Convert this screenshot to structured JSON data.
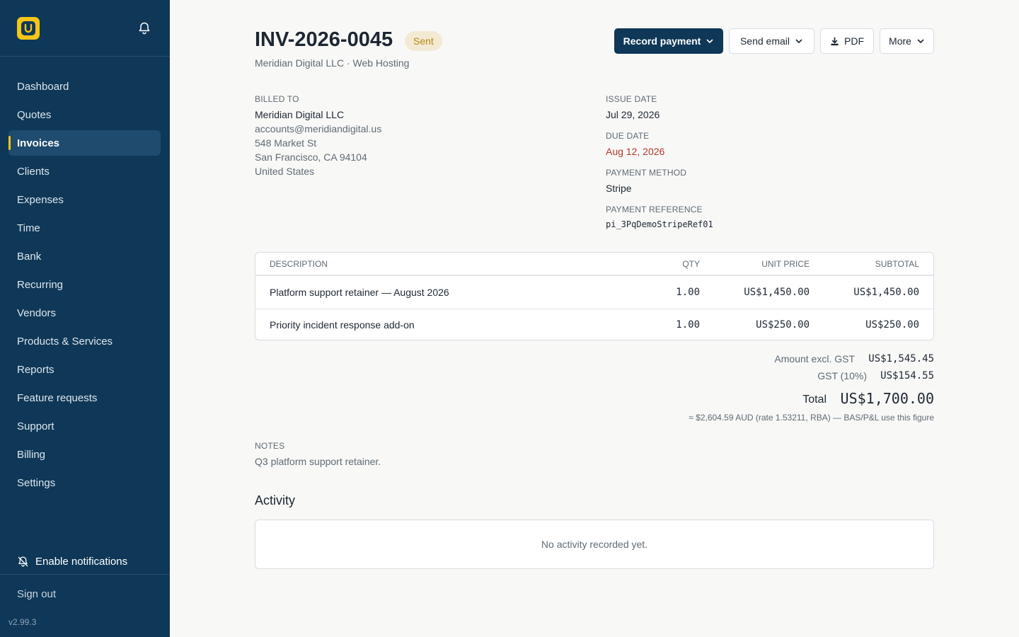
{
  "sidebar": {
    "logo_letter": "U",
    "nav": [
      {
        "label": "Dashboard",
        "active": false
      },
      {
        "label": "Quotes",
        "active": false
      },
      {
        "label": "Invoices",
        "active": true
      },
      {
        "label": "Clients",
        "active": false
      },
      {
        "label": "Expenses",
        "active": false
      },
      {
        "label": "Time",
        "active": false
      },
      {
        "label": "Bank",
        "active": false
      },
      {
        "label": "Recurring",
        "active": false
      },
      {
        "label": "Vendors",
        "active": false
      },
      {
        "label": "Products & Services",
        "active": false
      },
      {
        "label": "Reports",
        "active": false
      },
      {
        "label": "Feature requests",
        "active": false
      },
      {
        "label": "Support",
        "active": false
      },
      {
        "label": "Billing",
        "active": false
      },
      {
        "label": "Settings",
        "active": false
      }
    ],
    "enable_notifications": "Enable notifications",
    "sign_out": "Sign out",
    "version": "v2.99.3"
  },
  "invoice": {
    "number": "INV-2026-0045",
    "status": "Sent",
    "subtitle": "Meridian Digital LLC · Web Hosting"
  },
  "actions": {
    "record_payment": "Record payment",
    "send_email": "Send email",
    "pdf": "PDF",
    "more": "More"
  },
  "billed_to": {
    "label": "BILLED TO",
    "name": "Meridian Digital LLC",
    "email": "accounts@meridiandigital.us",
    "street": "548 Market St",
    "city": "San Francisco, CA 94104",
    "country": "United States"
  },
  "details": {
    "issue_date_label": "ISSUE DATE",
    "issue_date": "Jul 29, 2026",
    "due_date_label": "DUE DATE",
    "due_date": "Aug 12, 2026",
    "payment_method_label": "PAYMENT METHOD",
    "payment_method": "Stripe",
    "payment_reference_label": "PAYMENT REFERENCE",
    "payment_reference": "pi_3PqDemoStripeRef01"
  },
  "line_items": {
    "headers": {
      "description": "DESCRIPTION",
      "qty": "QTY",
      "unit_price": "UNIT PRICE",
      "subtotal": "SUBTOTAL"
    },
    "rows": [
      {
        "description": "Platform support retainer — August 2026",
        "qty": "1.00",
        "unit_price": "US$1,450.00",
        "subtotal": "US$1,450.00"
      },
      {
        "description": "Priority incident response add-on",
        "qty": "1.00",
        "unit_price": "US$250.00",
        "subtotal": "US$250.00"
      }
    ]
  },
  "totals": {
    "excl_label": "Amount excl. GST",
    "excl_value": "US$1,545.45",
    "gst_label": "GST (10%)",
    "gst_value": "US$154.55",
    "total_label": "Total",
    "total_value": "US$1,700.00",
    "conversion_note": "≈ $2,604.59 AUD (rate 1.53211, RBA) — BAS/P&L use this figure"
  },
  "notes": {
    "label": "NOTES",
    "text": "Q3 platform support retainer."
  },
  "activity": {
    "title": "Activity",
    "empty": "No activity recorded yet."
  },
  "colors": {
    "sidebar_bg": "#0f3858",
    "accent_yellow": "#f5c518",
    "primary_button": "#0f3858",
    "due_date": "#b3392f",
    "status_badge_bg": "#f3ead4",
    "status_badge_text": "#b8860b"
  },
  "icons": {
    "bell": "bell-icon",
    "bell_off": "bell-off-icon",
    "download": "download-icon",
    "chevron": "chevron-down-icon"
  }
}
